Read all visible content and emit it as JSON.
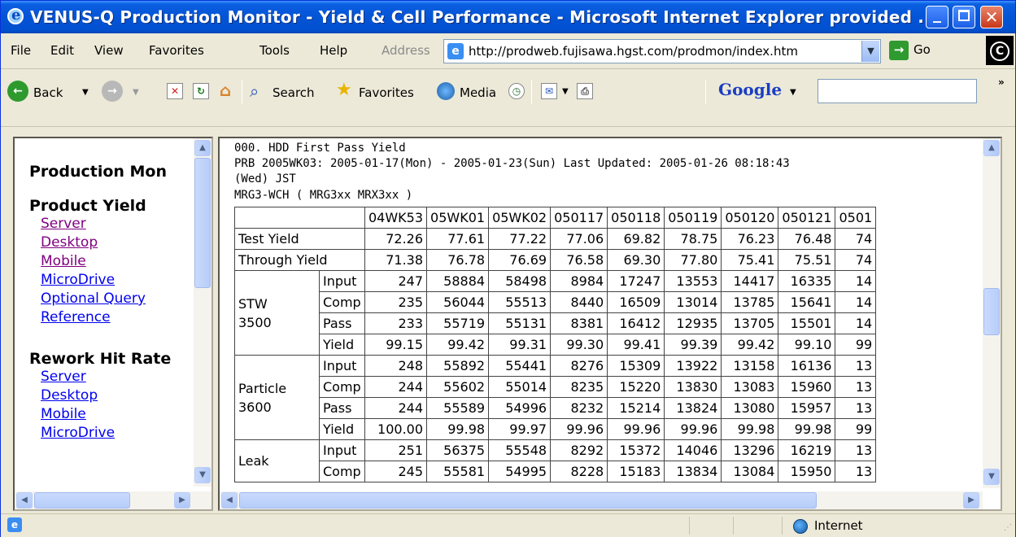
{
  "window": {
    "title": "VENUS-Q Production Monitor - Yield & Cell Performance - Microsoft Internet Explorer provided ..."
  },
  "menu": {
    "items": [
      "File",
      "Edit",
      "View",
      "Favorites",
      "Tools",
      "Help"
    ],
    "address_label": "Address",
    "url": "http://prodweb.fujisawa.hgst.com/prodmon/index.htm",
    "go_label": "Go"
  },
  "toolbar": {
    "back_label": "Back",
    "search_label": "Search",
    "favorites_label": "Favorites",
    "media_label": "Media",
    "google_label": "Google",
    "google_query": ""
  },
  "nav": {
    "title": "Production Mon",
    "sections": [
      {
        "heading": "Product Yield",
        "links": [
          "Server",
          "Desktop",
          "Mobile",
          "MicroDrive",
          "Optional Query",
          "Reference"
        ]
      },
      {
        "heading": "Rework Hit Rate",
        "links": [
          "Server",
          "Desktop",
          "Mobile",
          "MicroDrive"
        ]
      }
    ]
  },
  "report": {
    "line1": "000. HDD First Pass Yield",
    "line2": "PRB  2005WK03: 2005-01-17(Mon) - 2005-01-23(Sun)  Last Updated: 2005-01-26 08:18:43",
    "line3": "(Wed) JST",
    "line4": "MRG3-WCH ( MRG3xx MRX3xx )"
  },
  "table": {
    "columns": [
      "04WK53",
      "05WK01",
      "05WK02",
      "050117",
      "050118",
      "050119",
      "050120",
      "050121",
      "0501"
    ],
    "summary": [
      {
        "label": "Test Yield",
        "values": [
          "72.26",
          "77.61",
          "77.22",
          "77.06",
          "69.82",
          "78.75",
          "76.23",
          "76.48",
          "74"
        ]
      },
      {
        "label": "Through Yield",
        "values": [
          "71.38",
          "76.78",
          "76.69",
          "76.58",
          "69.30",
          "77.80",
          "75.41",
          "75.51",
          "74"
        ]
      }
    ],
    "groups": [
      {
        "name": "STW\n3500",
        "rows": [
          {
            "label": "Input",
            "values": [
              "247",
              "58884",
              "58498",
              "8984",
              "17247",
              "13553",
              "14417",
              "16335",
              "14"
            ]
          },
          {
            "label": "Comp",
            "values": [
              "235",
              "56044",
              "55513",
              "8440",
              "16509",
              "13014",
              "13785",
              "15641",
              "14"
            ]
          },
          {
            "label": "Pass",
            "values": [
              "233",
              "55719",
              "55131",
              "8381",
              "16412",
              "12935",
              "13705",
              "15501",
              "14"
            ]
          },
          {
            "label": "Yield",
            "values": [
              "99.15",
              "99.42",
              "99.31",
              "99.30",
              "99.41",
              "99.39",
              "99.42",
              "99.10",
              "99"
            ]
          }
        ]
      },
      {
        "name": "Particle\n3600",
        "rows": [
          {
            "label": "Input",
            "values": [
              "248",
              "55892",
              "55441",
              "8276",
              "15309",
              "13922",
              "13158",
              "16136",
              "13"
            ]
          },
          {
            "label": "Comp",
            "values": [
              "244",
              "55602",
              "55014",
              "8235",
              "15220",
              "13830",
              "13083",
              "15960",
              "13"
            ]
          },
          {
            "label": "Pass",
            "values": [
              "244",
              "55589",
              "54996",
              "8232",
              "15214",
              "13824",
              "13080",
              "15957",
              "13"
            ]
          },
          {
            "label": "Yield",
            "values": [
              "100.00",
              "99.98",
              "99.97",
              "99.96",
              "99.96",
              "99.96",
              "99.98",
              "99.98",
              "99"
            ]
          }
        ]
      },
      {
        "name": "Leak",
        "rows": [
          {
            "label": "Input",
            "values": [
              "251",
              "56375",
              "55548",
              "8292",
              "15372",
              "14046",
              "13296",
              "16219",
              "13"
            ]
          },
          {
            "label": "Comp",
            "values": [
              "245",
              "55581",
              "54995",
              "8228",
              "15183",
              "13834",
              "13084",
              "15950",
              "13"
            ]
          }
        ]
      }
    ]
  },
  "status": {
    "zone": "Internet"
  }
}
